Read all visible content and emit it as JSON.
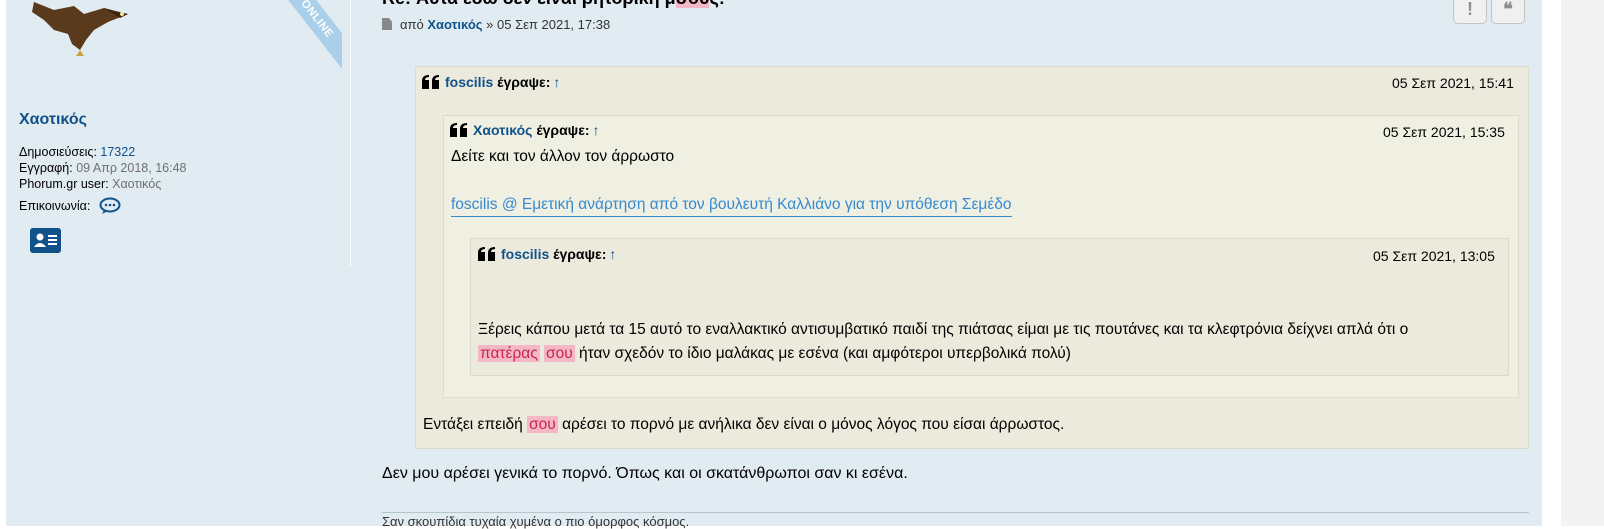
{
  "post": {
    "title_prefix": "Re: Αυτά εδώ δεν είναι ρητορική μ",
    "title_highlight": "σου",
    "title_suffix": "ς!",
    "meta": {
      "by_label": "από",
      "author": "Χαοτικός",
      "separator": "»",
      "datetime": "05 Σεπ 2021, 17:38"
    },
    "buttons": {
      "report_symbol": "!",
      "quote_symbol": "❝"
    },
    "body_text": "Δεν μου αρέσει γενικά το πορνό. Όπως και οι σκατάνθρωποι σαν κι εσένα.",
    "signature": "Σαν σκουπίδια τυχαία χυμένα ο πιο όμορφος κόσμος."
  },
  "profile": {
    "online_label": "ONLINE",
    "username": "Χαοτικός",
    "posts_label": "Δημοσιεύσεις:",
    "posts_value": "17322",
    "joined_label": "Εγγραφή:",
    "joined_value": "09 Απρ 2018, 16:48",
    "phorum_label": "Phorum.gr user:",
    "phorum_value": "Χαοτικός",
    "contact_label": "Επικοινωνία:"
  },
  "quote1": {
    "author": "foscilis",
    "wrote": "έγραψε:",
    "arrow": "↑",
    "date": "05 Σεπ 2021, 15:41",
    "text_before": "Εντάξει επειδή",
    "text_hl": "σου",
    "text_after": "αρέσει το πορνό με ανήλικα δεν είναι ο μόνος λόγος που είσαι άρρωστος."
  },
  "quote2": {
    "author": "Χαοτικός",
    "wrote": "έγραψε:",
    "arrow": "↑",
    "date": "05 Σεπ 2021, 15:35",
    "text": "Δείτε και τον άλλον τον άρρωστο",
    "link": "foscilis @ Εμετική ανάρτηση από τον βουλευτή Καλλιάνο για την υπόθεση Σεμέδο"
  },
  "quote3": {
    "author": "foscilis",
    "wrote": "έγραψε:",
    "arrow": "↑",
    "date": "05 Σεπ 2021, 13:05",
    "line1": "Ξέρεις κάπου μετά τα 15 αυτό το εναλλακτικό αντισυμβατικό παιδί της πιάτσας είμαι με τις πουτάνες και τα κλεφτρόνια δείχνει απλά ότι ο",
    "hl1": "πατέρας",
    "hl2": "σου",
    "line2_after": "ήταν σχεδόν το ίδιο μαλάκας με εσένα (και αμφότεροι υπερβολικά πολύ)"
  },
  "colors": {
    "post_bg": "#e1ebf2",
    "link": "#105289",
    "quote_bg": "#ebeadd",
    "highlight": "#f3b7c6"
  }
}
